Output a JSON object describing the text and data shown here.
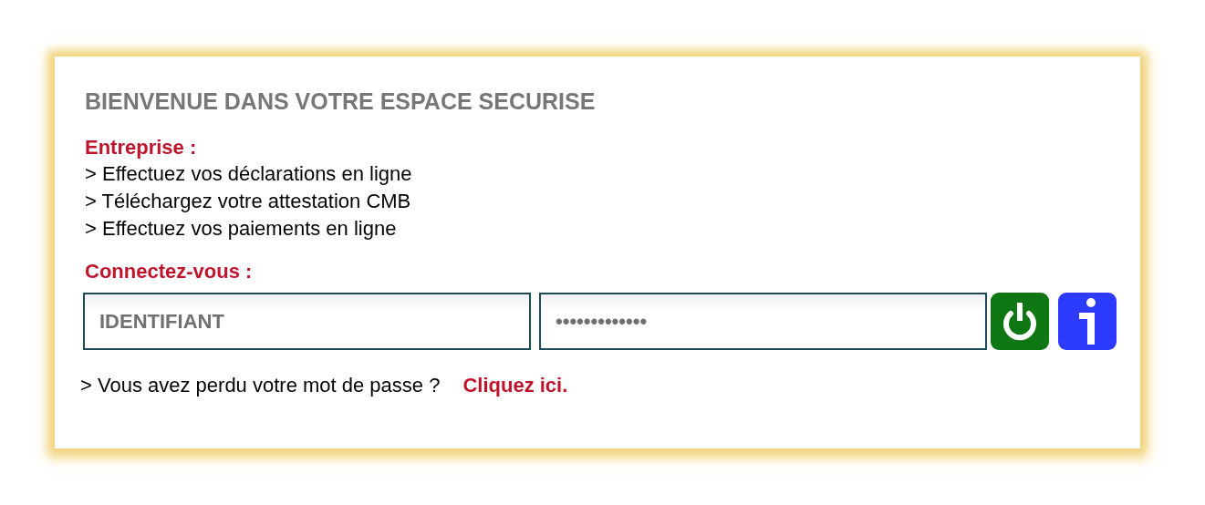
{
  "title": "BIENVENUE DANS VOTRE ESPACE SECURISE",
  "section_heading": "Entreprise :",
  "features": [
    "> Effectuez vos déclarations en ligne",
    "> Téléchargez votre attestation CMB",
    "> Effectuez vos paiements en ligne"
  ],
  "login_heading": "Connectez-vous :",
  "login": {
    "username": {
      "placeholder": "IDENTIFIANT"
    },
    "password": {
      "value": "•••••••••••••"
    }
  },
  "actions": [
    {
      "kind": "power"
    },
    {
      "kind": "info"
    }
  ],
  "forgot": {
    "text": "> Vous avez perdu votre mot de passe ?",
    "link": "Cliquez ici."
  }
}
